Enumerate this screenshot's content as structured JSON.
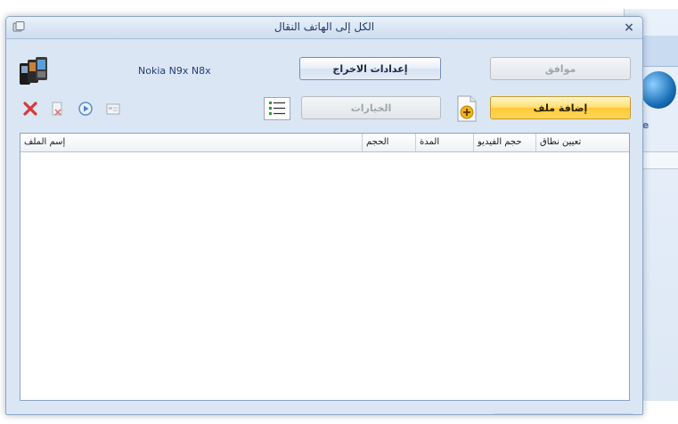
{
  "window": {
    "title": "الكل إلى الهاتف النقال",
    "close_label": "×"
  },
  "device": {
    "label": "Nokia N9x  N8x"
  },
  "buttons": {
    "ok": "موافق",
    "output_settings": "إعدادات الاخراج",
    "options": "الخيارات",
    "add_file": "إضافة ملف"
  },
  "table": {
    "columns": [
      "تعيين نطاق",
      "حجم الفيديو",
      "المدة",
      "الحجم",
      "إسم الملف"
    ],
    "rows": []
  },
  "background_app": {
    "partial_text": "ne"
  },
  "colors": {
    "primary_button": "#ffd75a",
    "dialog_bg": "#dbe6f4",
    "title_text": "#1f3b63"
  }
}
